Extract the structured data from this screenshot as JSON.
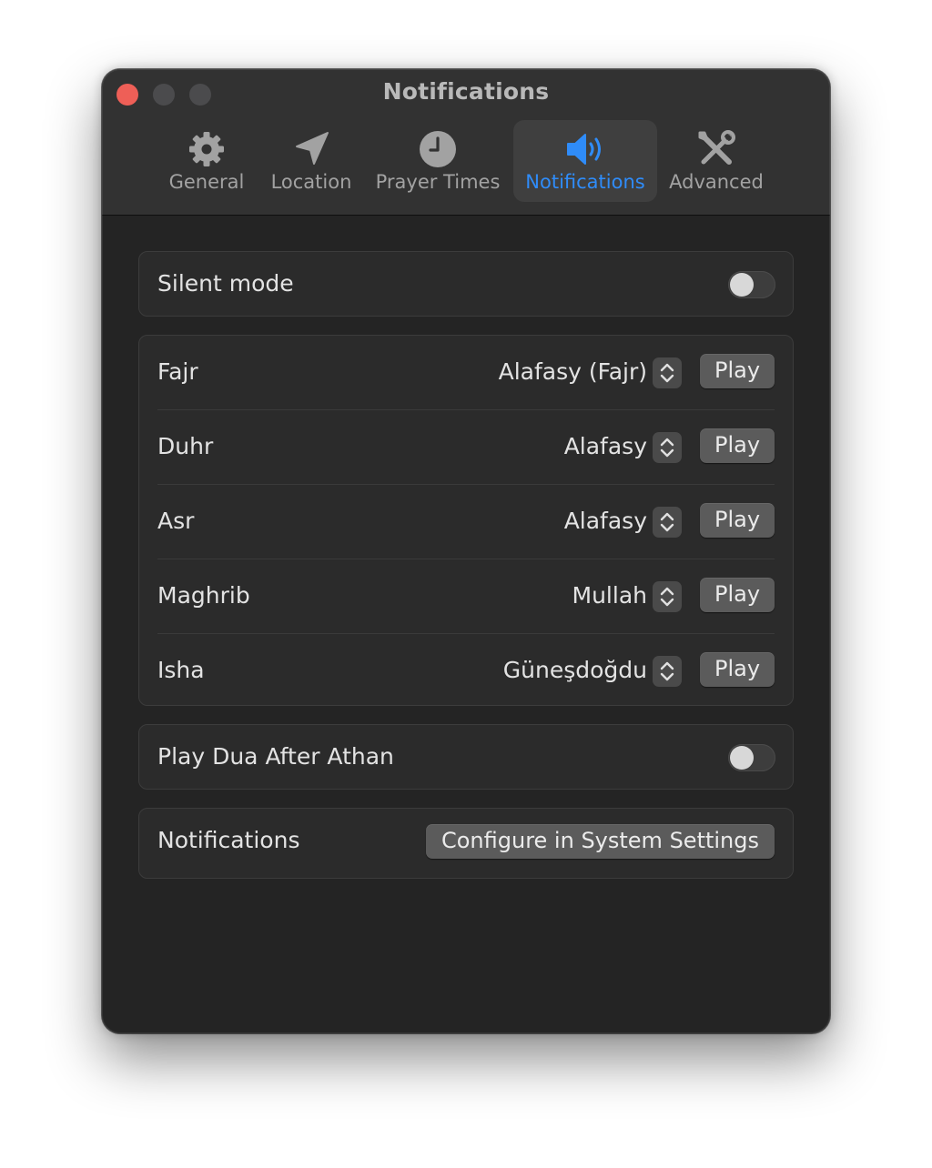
{
  "window": {
    "title": "Notifications"
  },
  "toolbar": {
    "tabs": [
      {
        "label": "General",
        "icon": "gear-icon",
        "active": false
      },
      {
        "label": "Location",
        "icon": "location-arrow-icon",
        "active": false
      },
      {
        "label": "Prayer Times",
        "icon": "clock-icon",
        "active": false
      },
      {
        "label": "Notifications",
        "icon": "speaker-icon",
        "active": true
      },
      {
        "label": "Advanced",
        "icon": "tools-icon",
        "active": false
      }
    ]
  },
  "silent_mode": {
    "label": "Silent mode",
    "enabled": false
  },
  "prayers": [
    {
      "name": "Fajr",
      "sound": "Alafasy (Fajr)",
      "play_label": "Play"
    },
    {
      "name": "Duhr",
      "sound": "Alafasy",
      "play_label": "Play"
    },
    {
      "name": "Asr",
      "sound": "Alafasy",
      "play_label": "Play"
    },
    {
      "name": "Maghrib",
      "sound": "Mullah",
      "play_label": "Play"
    },
    {
      "name": "Isha",
      "sound": "Güneşdoğdu",
      "play_label": "Play"
    }
  ],
  "dua": {
    "label": "Play Dua After Athan",
    "enabled": false
  },
  "notifications_row": {
    "label": "Notifications",
    "button_label": "Configure in System Settings"
  },
  "colors": {
    "accent": "#2f8cf9",
    "close": "#ee5f57",
    "window_bg": "#242424",
    "toolbar_bg": "#323232"
  }
}
